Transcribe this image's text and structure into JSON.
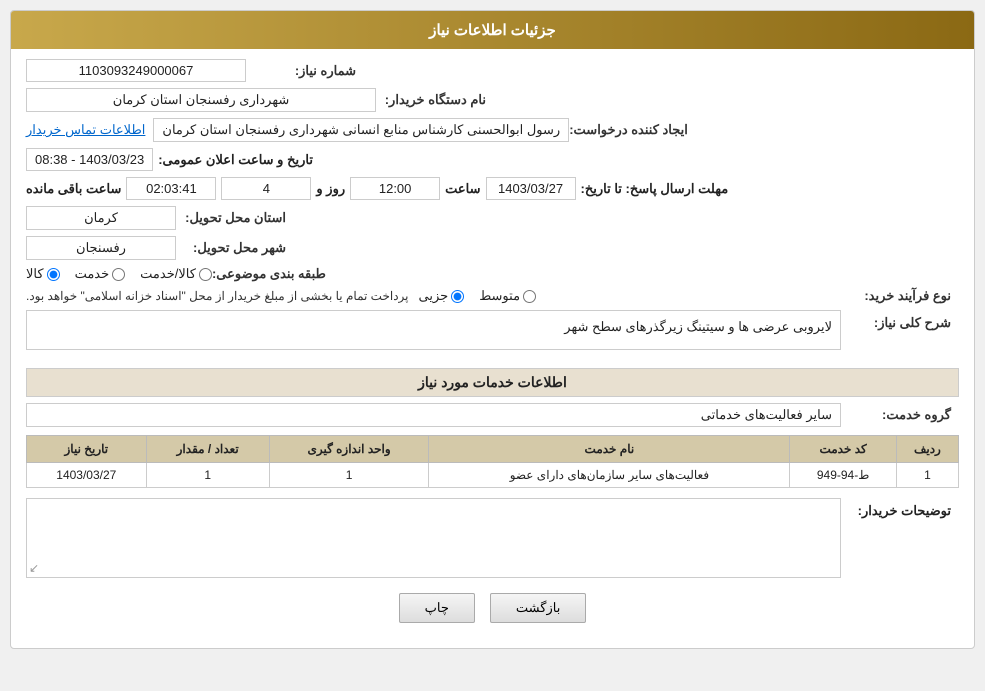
{
  "header": {
    "title": "جزئیات اطلاعات نیاز"
  },
  "fields": {
    "need_number_label": "شماره نیاز:",
    "need_number_value": "1103093249000067",
    "buyer_org_label": "نام دستگاه خریدار:",
    "buyer_org_value": "شهرداری رفسنجان استان کرمان",
    "creator_label": "ایجاد کننده درخواست:",
    "creator_value": "رسول ابوالحسنی کارشناس منابع انسانی شهرداری رفسنجان استان کرمان",
    "creator_link": "اطلاعات تماس خریدار",
    "announce_date_label": "تاریخ و ساعت اعلان عمومی:",
    "announce_date_value": "1403/03/23 - 08:38",
    "response_deadline_label": "مهلت ارسال پاسخ: تا تاریخ:",
    "response_date": "1403/03/27",
    "response_time": "12:00",
    "response_time_label": "ساعت",
    "response_days": "4",
    "response_days_label": "روز و",
    "response_remaining": "02:03:41",
    "response_remaining_label": "ساعت باقی مانده",
    "delivery_province_label": "استان محل تحویل:",
    "delivery_province_value": "کرمان",
    "delivery_city_label": "شهر محل تحویل:",
    "delivery_city_value": "رفسنجان",
    "category_label": "طبقه بندی موضوعی:",
    "category_options": [
      "کالا",
      "خدمت",
      "کالا/خدمت"
    ],
    "category_selected": "کالا",
    "purchase_type_label": "نوع فرآیند خرید:",
    "purchase_type_options": [
      "جزیی",
      "متوسط"
    ],
    "purchase_note": "پرداخت تمام یا بخشی از مبلغ خریدار از محل \"اسناد خزانه اسلامی\" خواهد بود.",
    "description_section_label": "شرح کلی نیاز:",
    "description_text": "لایروبی عرضی ها و سیتینگ زیرگذرهای سطح شهر",
    "services_section_label": "اطلاعات خدمات مورد نیاز",
    "service_group_label": "گروه خدمت:",
    "service_group_value": "سایر فعالیت‌های خدماتی",
    "table_headers": [
      "ردیف",
      "کد خدمت",
      "نام خدمت",
      "واحد اندازه گیری",
      "تعداد / مقدار",
      "تاریخ نیاز"
    ],
    "table_rows": [
      {
        "row": "1",
        "code": "ط-94-949",
        "name": "فعالیت‌های سایر سازمان‌های دارای عضو",
        "unit": "1",
        "quantity": "1",
        "date": "1403/03/27"
      }
    ],
    "notes_label": "توضیحات خریدار:",
    "notes_value": "",
    "btn_print": "چاپ",
    "btn_back": "بازگشت"
  }
}
